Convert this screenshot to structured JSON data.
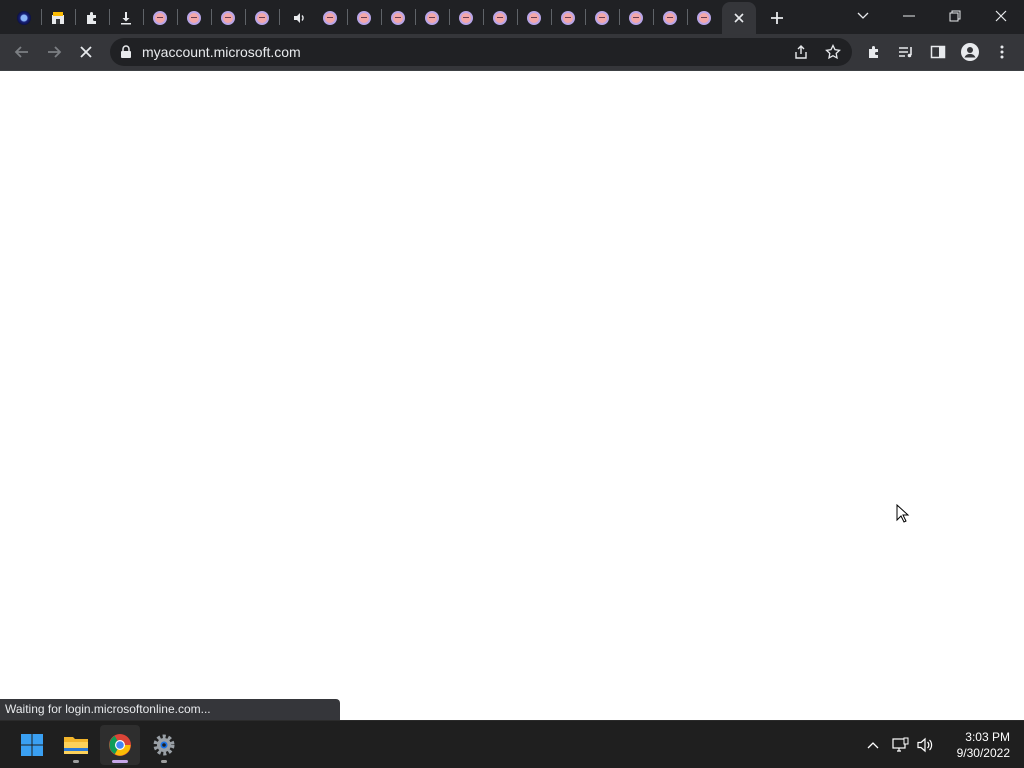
{
  "browser": {
    "url": "myaccount.microsoft.com",
    "status_text": "Waiting for login.microsoftonline.com...",
    "tabs": [
      {
        "icon": "space-logo-icon"
      },
      {
        "icon": "store-icon"
      },
      {
        "icon": "extensions-puzzle-icon"
      },
      {
        "icon": "download-icon"
      },
      {
        "icon": "mascot-favicon-icon"
      },
      {
        "icon": "mascot-favicon-icon"
      },
      {
        "icon": "mascot-favicon-icon"
      },
      {
        "icon": "mascot-favicon-icon"
      },
      {
        "icon": "speaker-audio-icon"
      },
      {
        "icon": "mascot-favicon-icon"
      },
      {
        "icon": "mascot-favicon-icon"
      },
      {
        "icon": "mascot-favicon-icon"
      },
      {
        "icon": "mascot-favicon-icon"
      },
      {
        "icon": "mascot-favicon-icon"
      },
      {
        "icon": "mascot-favicon-icon"
      },
      {
        "icon": "mascot-favicon-icon"
      },
      {
        "icon": "mascot-favicon-icon"
      },
      {
        "icon": "mascot-favicon-icon"
      },
      {
        "icon": "mascot-favicon-icon"
      },
      {
        "icon": "mascot-favicon-icon"
      },
      {
        "icon": "mascot-favicon-icon"
      }
    ],
    "active_tab": "loading-close-icon"
  },
  "taskbar": {
    "apps": [
      "start-windows-icon",
      "file-explorer-icon",
      "chrome-icon",
      "settings-gear-icon"
    ],
    "time": "3:03 PM",
    "date": "9/30/2022"
  },
  "colors": {
    "chrome_dark": "#202124",
    "toolbar": "#35363a",
    "page": "#ffffff",
    "taskbar": "#1f1f1f"
  }
}
